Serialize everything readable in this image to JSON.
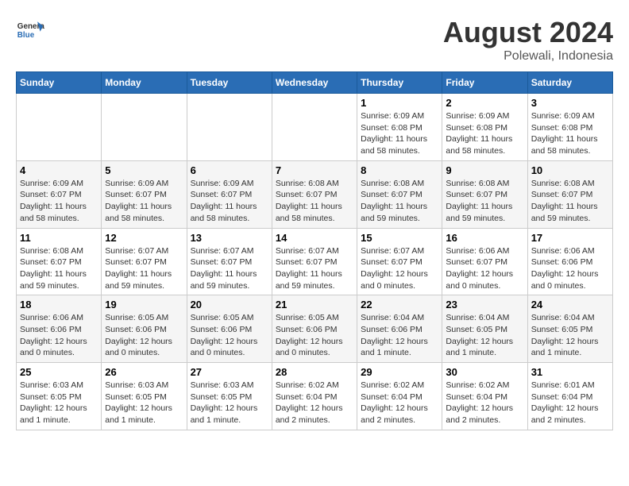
{
  "header": {
    "logo": {
      "general": "General",
      "blue": "Blue"
    },
    "title": "August 2024",
    "location": "Polewali, Indonesia"
  },
  "weekdays": [
    "Sunday",
    "Monday",
    "Tuesday",
    "Wednesday",
    "Thursday",
    "Friday",
    "Saturday"
  ],
  "weeks": [
    [
      {
        "day": "",
        "info": ""
      },
      {
        "day": "",
        "info": ""
      },
      {
        "day": "",
        "info": ""
      },
      {
        "day": "",
        "info": ""
      },
      {
        "day": "1",
        "info": "Sunrise: 6:09 AM\nSunset: 6:08 PM\nDaylight: 11 hours\nand 58 minutes."
      },
      {
        "day": "2",
        "info": "Sunrise: 6:09 AM\nSunset: 6:08 PM\nDaylight: 11 hours\nand 58 minutes."
      },
      {
        "day": "3",
        "info": "Sunrise: 6:09 AM\nSunset: 6:08 PM\nDaylight: 11 hours\nand 58 minutes."
      }
    ],
    [
      {
        "day": "4",
        "info": "Sunrise: 6:09 AM\nSunset: 6:07 PM\nDaylight: 11 hours\nand 58 minutes."
      },
      {
        "day": "5",
        "info": "Sunrise: 6:09 AM\nSunset: 6:07 PM\nDaylight: 11 hours\nand 58 minutes."
      },
      {
        "day": "6",
        "info": "Sunrise: 6:09 AM\nSunset: 6:07 PM\nDaylight: 11 hours\nand 58 minutes."
      },
      {
        "day": "7",
        "info": "Sunrise: 6:08 AM\nSunset: 6:07 PM\nDaylight: 11 hours\nand 58 minutes."
      },
      {
        "day": "8",
        "info": "Sunrise: 6:08 AM\nSunset: 6:07 PM\nDaylight: 11 hours\nand 59 minutes."
      },
      {
        "day": "9",
        "info": "Sunrise: 6:08 AM\nSunset: 6:07 PM\nDaylight: 11 hours\nand 59 minutes."
      },
      {
        "day": "10",
        "info": "Sunrise: 6:08 AM\nSunset: 6:07 PM\nDaylight: 11 hours\nand 59 minutes."
      }
    ],
    [
      {
        "day": "11",
        "info": "Sunrise: 6:08 AM\nSunset: 6:07 PM\nDaylight: 11 hours\nand 59 minutes."
      },
      {
        "day": "12",
        "info": "Sunrise: 6:07 AM\nSunset: 6:07 PM\nDaylight: 11 hours\nand 59 minutes."
      },
      {
        "day": "13",
        "info": "Sunrise: 6:07 AM\nSunset: 6:07 PM\nDaylight: 11 hours\nand 59 minutes."
      },
      {
        "day": "14",
        "info": "Sunrise: 6:07 AM\nSunset: 6:07 PM\nDaylight: 11 hours\nand 59 minutes."
      },
      {
        "day": "15",
        "info": "Sunrise: 6:07 AM\nSunset: 6:07 PM\nDaylight: 12 hours\nand 0 minutes."
      },
      {
        "day": "16",
        "info": "Sunrise: 6:06 AM\nSunset: 6:07 PM\nDaylight: 12 hours\nand 0 minutes."
      },
      {
        "day": "17",
        "info": "Sunrise: 6:06 AM\nSunset: 6:06 PM\nDaylight: 12 hours\nand 0 minutes."
      }
    ],
    [
      {
        "day": "18",
        "info": "Sunrise: 6:06 AM\nSunset: 6:06 PM\nDaylight: 12 hours\nand 0 minutes."
      },
      {
        "day": "19",
        "info": "Sunrise: 6:05 AM\nSunset: 6:06 PM\nDaylight: 12 hours\nand 0 minutes."
      },
      {
        "day": "20",
        "info": "Sunrise: 6:05 AM\nSunset: 6:06 PM\nDaylight: 12 hours\nand 0 minutes."
      },
      {
        "day": "21",
        "info": "Sunrise: 6:05 AM\nSunset: 6:06 PM\nDaylight: 12 hours\nand 0 minutes."
      },
      {
        "day": "22",
        "info": "Sunrise: 6:04 AM\nSunset: 6:06 PM\nDaylight: 12 hours\nand 1 minute."
      },
      {
        "day": "23",
        "info": "Sunrise: 6:04 AM\nSunset: 6:05 PM\nDaylight: 12 hours\nand 1 minute."
      },
      {
        "day": "24",
        "info": "Sunrise: 6:04 AM\nSunset: 6:05 PM\nDaylight: 12 hours\nand 1 minute."
      }
    ],
    [
      {
        "day": "25",
        "info": "Sunrise: 6:03 AM\nSunset: 6:05 PM\nDaylight: 12 hours\nand 1 minute."
      },
      {
        "day": "26",
        "info": "Sunrise: 6:03 AM\nSunset: 6:05 PM\nDaylight: 12 hours\nand 1 minute."
      },
      {
        "day": "27",
        "info": "Sunrise: 6:03 AM\nSunset: 6:05 PM\nDaylight: 12 hours\nand 1 minute."
      },
      {
        "day": "28",
        "info": "Sunrise: 6:02 AM\nSunset: 6:04 PM\nDaylight: 12 hours\nand 2 minutes."
      },
      {
        "day": "29",
        "info": "Sunrise: 6:02 AM\nSunset: 6:04 PM\nDaylight: 12 hours\nand 2 minutes."
      },
      {
        "day": "30",
        "info": "Sunrise: 6:02 AM\nSunset: 6:04 PM\nDaylight: 12 hours\nand 2 minutes."
      },
      {
        "day": "31",
        "info": "Sunrise: 6:01 AM\nSunset: 6:04 PM\nDaylight: 12 hours\nand 2 minutes."
      }
    ]
  ]
}
